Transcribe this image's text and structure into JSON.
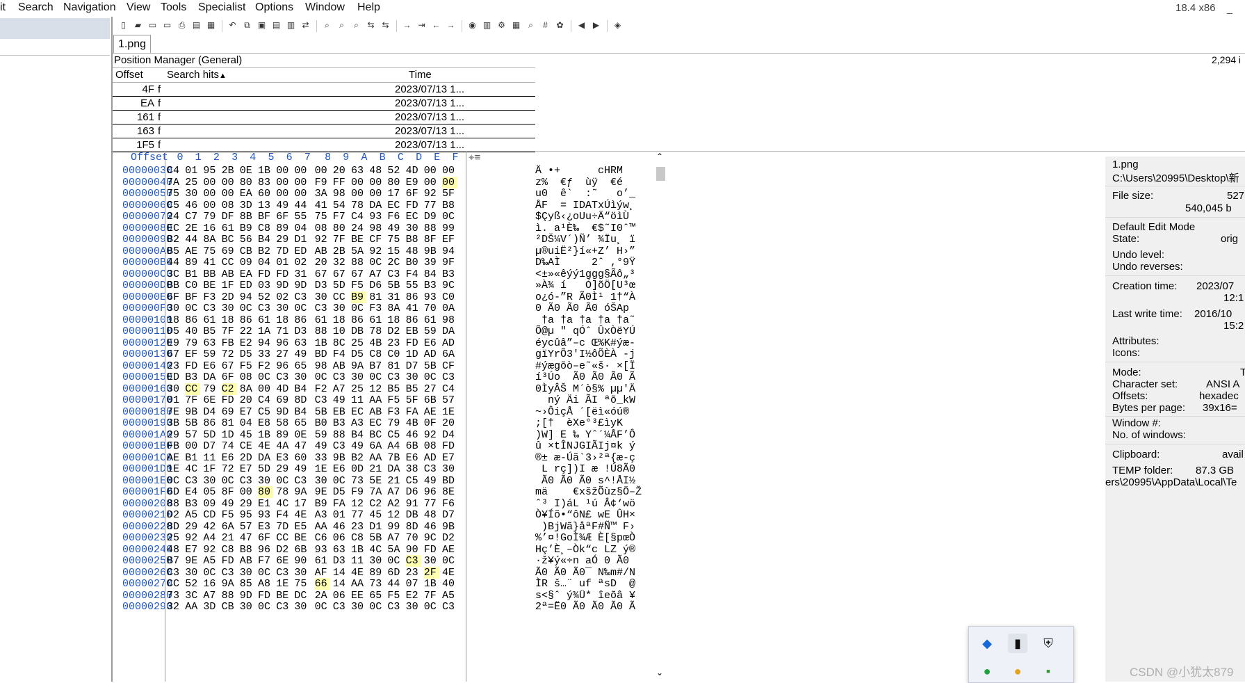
{
  "menubar": {
    "items": [
      "it",
      "Search",
      "Navigation",
      "View",
      "Tools",
      "Specialist",
      "Options",
      "Window",
      "Help"
    ],
    "version": "18.4 x86",
    "minimize": "_"
  },
  "toolbar": {
    "icons": [
      "new-file-icon",
      "open-file-icon",
      "save-icon",
      "save-all-icon",
      "print-icon",
      "properties-icon",
      "image-icon",
      "undo-icon",
      "copy-icon",
      "paste-icon",
      "cut-icon",
      "clipboard-icon",
      "convert-icon",
      "find-icon",
      "find-text-icon",
      "find-hex-icon",
      "replace-icon",
      "replace-hex-icon",
      "goto-offset-icon",
      "goto-sector-icon",
      "back-icon",
      "forward-icon",
      "disk-icon",
      "ram-icon",
      "tools-icon",
      "calculator-icon",
      "search-zoom-icon",
      "hash-icon",
      "gear-icon",
      "prev-icon",
      "next-icon",
      "book-icon"
    ]
  },
  "tab": {
    "label": "1.png"
  },
  "position_manager": {
    "title": "Position Manager (General)",
    "count": "2,294 i",
    "headers": {
      "offset": "Offset",
      "hits": "Search hits",
      "time": "Time"
    },
    "sort_arrow": "▲",
    "rows": [
      {
        "offset": "4F",
        "hit": "f",
        "time": "2023/07/13  1..."
      },
      {
        "offset": "EA",
        "hit": "f",
        "time": "2023/07/13  1..."
      },
      {
        "offset": "161",
        "hit": "f",
        "time": "2023/07/13  1..."
      },
      {
        "offset": "163",
        "hit": "f",
        "time": "2023/07/13  1..."
      },
      {
        "offset": "1F5",
        "hit": "f",
        "time": "2023/07/13  1..."
      }
    ]
  },
  "hex": {
    "header_offset": "Offset",
    "header_cols": [
      "0",
      "1",
      "2",
      "3",
      "4",
      "5",
      "6",
      "7",
      "8",
      "9",
      "A",
      "B",
      "C",
      "D",
      "E",
      "F"
    ],
    "rows": [
      {
        "off": "00000030",
        "b": "C4 01 95 2B 0E 1B 00 00 00 20 63 48 52 4D 00 00",
        "t": "Ä •+      cHRM  ",
        "hl": []
      },
      {
        "off": "00000040",
        "b": "7A 25 00 00 80 83 00 00 F9 FF 00 00 80 E9 00 00",
        "t": "z%  €ƒ  ùÿ  €é  ",
        "hl": [
          15
        ]
      },
      {
        "off": "00000050",
        "b": "75 30 00 00 EA 60 00 00 3A 98 00 00 17 6F 92 5F",
        "t": "u0  ê`  :˜   o’_",
        "hl": []
      },
      {
        "off": "00000060",
        "b": "C5 46 00 08 3D 13 49 44 41 54 78 DA EC FD 77 B8",
        "t": "ÅF  = IDATxÚìýw¸",
        "hl": []
      },
      {
        "off": "00000070",
        "b": "24 C7 79 DF 8B BF 6F 55 75 F7 C4 93 F6 EC D9 0C",
        "t": "$Çyß‹¿oUu÷Ä“öìÙ ",
        "hl": []
      },
      {
        "off": "00000080",
        "b": "EC 2E 16 61 B9 C8 89 04 08 80 24 98 49 30 88 99",
        "t": "ì. a¹È‰  €$˜I0ˆ™",
        "hl": []
      },
      {
        "off": "00000090",
        "b": "B2 44 8A BC 56 B4 29 D1 92 7F BE CF 75 B8 8F EF",
        "t": "²DŠ¼V´)Ñ’ ¾Ïu¸ ï",
        "hl": []
      },
      {
        "off": "000000A0",
        "b": "B5 AE 75 69 CB B2 7D ED AB 2B 5A 92 15 48 9B 94",
        "t": "µ®uiË²}í«+Z’ H›”",
        "hl": []
      },
      {
        "off": "000000B0",
        "b": "44 89 41 CC 09 04 01 02 20 32 88 0C 2C B0 39 9F",
        "t": "D‰AÌ     2ˆ ,°9Ÿ",
        "hl": []
      },
      {
        "off": "000000C0",
        "b": "3C B1 BB AB EA FD FD 31 67 67 67 A7 C3 F4 84 B3",
        "t": "<±»«êýý1ggg§Ãô„³",
        "hl": []
      },
      {
        "off": "000000D0",
        "b": "BB C0 BE 1F ED 03 9D 9D D3 5D F5 D6 5B 55 B3 9C",
        "t": "»À¾ í   Ó]õÖ[U³œ",
        "hl": []
      },
      {
        "off": "000000E0",
        "b": "6F BF F3 2D 94 52 02 C3 30 CC B9 81 31 86 93 C0",
        "t": "o¿ó-”R Ã0Ì¹ 1†“À",
        "hl": [
          10
        ]
      },
      {
        "off": "000000F0",
        "b": "30 0C C3 30 0C C3 30 0C C3 30 0C F3 8A 41 70 0A",
        "t": "0 Ã0 Ã0 Ã0 óŠAp ",
        "hl": []
      },
      {
        "off": "00000100",
        "b": "18 86 61 18 86 61 18 86 61 18 86 61 18 86 61 98",
        "t": " †a †a †a †a †a˜",
        "hl": []
      },
      {
        "off": "00000110",
        "b": "D5 40 B5 7F 22 1A 71 D3 88 10 DB 78 D2 EB 59 DA",
        "t": "Õ@µ \" qÓˆ ÛxÒëYÚ",
        "hl": []
      },
      {
        "off": "00000120",
        "b": "E9 79 63 FB E2 94 96 63 1B 8C 25 4B 23 FD E6 AD",
        "t": "éycûâ”–c Œ%K#ýæ-",
        "hl": []
      },
      {
        "off": "00000130",
        "b": "67 EF 59 72 D5 33 27 49 BD F4 D5 C8 C0 1D AD 6A",
        "t": "gïYrÕ3'I½ôÕÈÀ -j",
        "hl": []
      },
      {
        "off": "00000140",
        "b": "23 FD E6 67 F5 F2 96 65 98 AB 9A B7 81 D7 5B CF",
        "t": "#ýægõò–e˜«š· ×[Ï",
        "hl": []
      },
      {
        "off": "00000150",
        "b": "ED B3 DA 6F 08 0C C3 30 0C C3 30 0C C3 30 0C C3",
        "t": "í³Úo  Ã0 Ã0 Ã0 Ã",
        "hl": []
      },
      {
        "off": "00000160",
        "b": "30 CC 79 C2 8A 00 4D B4 F2 A7 25 12 B5 B5 27 C4",
        "t": "0ÌyÂŠ M´ò§% µµ'Ä",
        "hl": [
          1,
          3
        ]
      },
      {
        "off": "00000170",
        "b": "01 7F 6E FD 20 C4 69 8D C3 49 11 AA F5 5F 6B 57",
        "t": "  ný Äi ÃI ªõ_kW",
        "hl": []
      },
      {
        "off": "00000180",
        "b": "7E 9B D4 69 E7 C5 9D B4 5B EB EC AB F3 FA AE 1E",
        "t": "~›ÔiçÅ ´[ëì«óú® ",
        "hl": []
      },
      {
        "off": "00000190",
        "b": "3B 5B 86 81 04 E8 58 65 B0 B3 A3 EC 79 4B 0F 20",
        "t": ";[†  èXe°³£ìyK  ",
        "hl": []
      },
      {
        "off": "000001A0",
        "b": "29 57 5D 1D 45 1B 89 0E 59 88 B4 BC C5 46 92 D4",
        "t": ")W] E ‰ Yˆ´¼ÅF’Ô",
        "hl": []
      },
      {
        "off": "000001B0",
        "b": "FB 00 D7 74 CE 4E 4A 47 49 C3 49 6A A4 6B 08 FD",
        "t": "û ×tÎNJGIÃIj¤k ý",
        "hl": []
      },
      {
        "off": "000001C0",
        "b": "AE B1 11 E6 2D DA E3 60 33 9B B2 AA 7B E6 AD E7",
        "t": "®± æ-Úã`3›²ª{æ-ç",
        "hl": []
      },
      {
        "off": "000001D0",
        "b": "1E 4C 1F 72 E7 5D 29 49 1E E6 0D 21 DA 38 C3 30",
        "t": " L rç])I æ !Ú8Ã0",
        "hl": []
      },
      {
        "off": "000001E0",
        "b": "0C C3 30 0C C3 30 0C C3 30 0C 73 5E 21 C5 49 BD",
        "t": " Ã0 Ã0 Ã0 s^!ÅI½",
        "hl": []
      },
      {
        "off": "000001F0",
        "b": "6D E4 05 8F 00 80 78 9A 9E D5 F9 7A A7 D6 96 8E",
        "t": "mä    €xšžÕùz§Ö–Ž",
        "hl": [
          5
        ]
      },
      {
        "off": "00000200",
        "b": "88 B3 09 49 29 E1 4C 17 B9 FA 12 C2 A2 91 77 F6",
        "t": "ˆ³ I)áL ¹ú Â¢‘wö",
        "hl": []
      },
      {
        "off": "00000210",
        "b": "D2 A5 CD F5 95 93 F4 4E A3 01 77 45 12 DB 48 D7",
        "t": "Ò¥Íõ•“ôN£ wE ÛH×",
        "hl": []
      },
      {
        "off": "00000220",
        "b": "8D 29 42 6A 57 E3 7D E5 AA 46 23 D1 99 8D 46 9B",
        "t": " )BjWã}åªF#Ñ™ F›",
        "hl": []
      },
      {
        "off": "00000230",
        "b": "25 92 A4 21 47 6F CC BE C6 06 C8 5B A7 70 9C D2",
        "t": "%’¤!GoÌ¾Æ È[§pœÒ",
        "hl": []
      },
      {
        "off": "00000240",
        "b": "48 E7 92 C8 B8 96 D2 6B 93 63 1B 4C 5A 90 FD AE",
        "t": "Hç’È¸–Òk“c LZ ý®",
        "hl": []
      },
      {
        "off": "00000250",
        "b": "B7 9E A5 FD AB F7 6E 90 61 D3 11 30 0C C3 30 0C",
        "t": "·ž¥ý«÷n aÓ 0 Ã0 ",
        "hl": [
          13
        ]
      },
      {
        "off": "00000260",
        "b": "C3 30 0C C3 30 0C C3 30 AF 14 4E 89 6D 23 2F 4E",
        "t": "Ã0 Ã0 Ã0¯ N‰m#/N",
        "hl": [
          14
        ]
      },
      {
        "off": "00000270",
        "b": "CC 52 16 9A 85 A8 1E 75 66 14 AA 73 44 07 1B 40",
        "t": "ÌR š…¨ uf ªsD  @",
        "hl": [
          8
        ]
      },
      {
        "off": "00000280",
        "b": "73 3C A7 88 9D FD BE DC 2A 06 EE 65 F5 E2 7F A5",
        "t": "s<§ˆ ý¾Ü* îeõâ ¥",
        "hl": []
      },
      {
        "off": "00000290",
        "b": "32 AA 3D CB 30 0C C3 30 0C C3 30 0C C3 30 0C C3",
        "t": "2ª=Ë0 Ã0 Ã0 Ã0 Ã",
        "hl": []
      }
    ]
  },
  "info_panel": {
    "filename": "1.png",
    "path": "C:\\Users\\20995\\Desktop\\新",
    "file_size_label": "File size:",
    "file_size_kb": "527",
    "file_size_bytes": "540,045 b",
    "edit_mode_label": "Default Edit Mode",
    "state_label": "State:",
    "state_value": "orig",
    "undo_level_label": "Undo level:",
    "undo_reverses_label": "Undo reverses:",
    "creation_label": "Creation time:",
    "creation_date": "2023/07",
    "creation_time": "12:1",
    "lastwrite_label": "Last write time:",
    "lastwrite_date": "2016/10",
    "lastwrite_time": "15:2",
    "attributes_label": "Attributes:",
    "icons_label": "Icons:",
    "mode_label": "Mode:",
    "mode_value": "T",
    "charset_label": "Character set:",
    "charset_value": "ANSI A",
    "offsets_label": "Offsets:",
    "offsets_value": "hexadec",
    "bpp_label": "Bytes per page:",
    "bpp_value": "39x16=",
    "window_label": "Window #:",
    "nwin_label": "No. of windows:",
    "clipboard_label": "Clipboard:",
    "clipboard_value": "avail",
    "temp_label": "TEMP folder:",
    "temp_value": "87.3 GB",
    "temp_path": "ers\\20995\\AppData\\Local\\Te"
  },
  "watermark": "CSDN @小犹太879",
  "colors": {
    "offset_blue": "#1d56c7",
    "highlight": "#ffffb0",
    "panel_bg": "#f0f0f0"
  }
}
